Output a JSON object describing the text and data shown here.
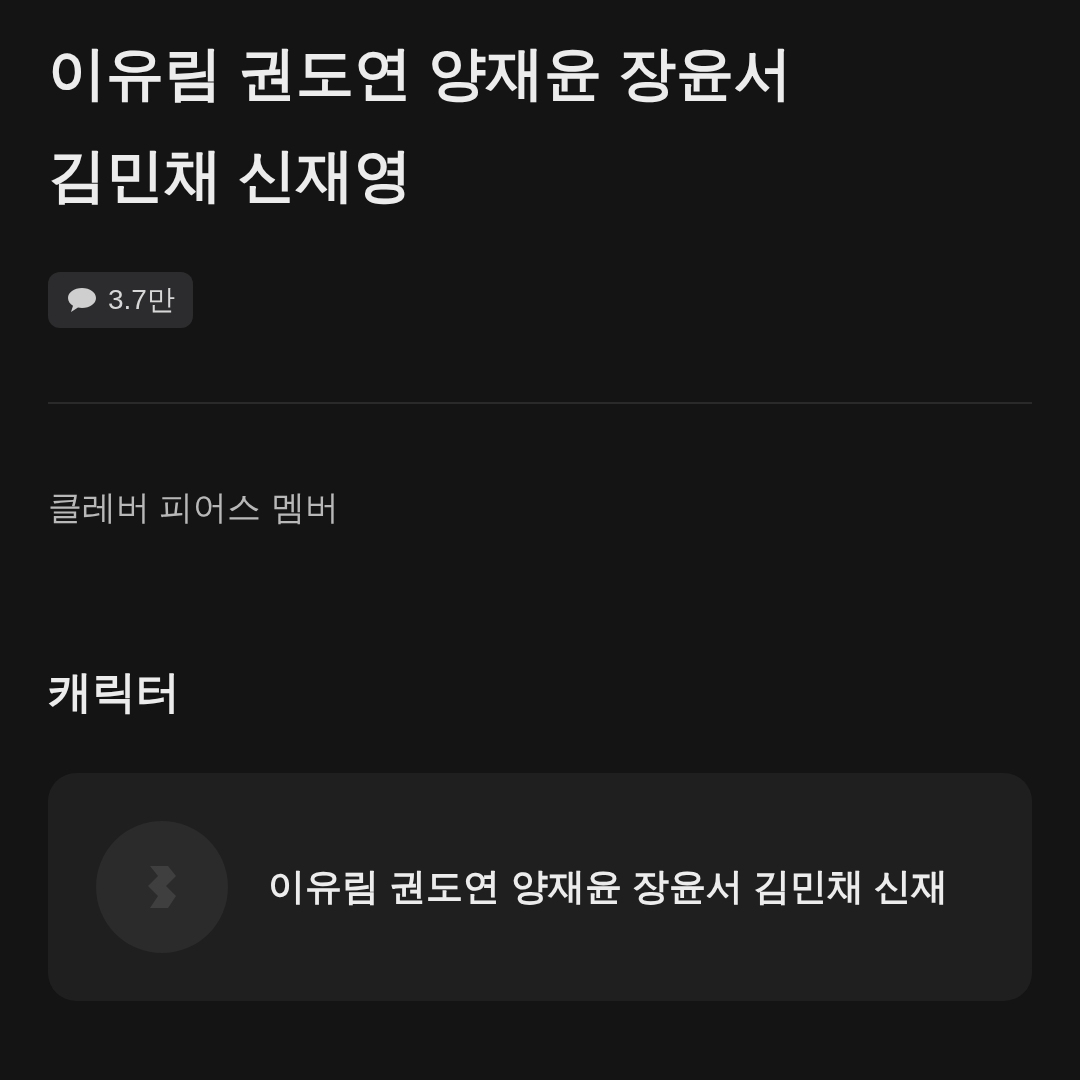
{
  "title": "이유림 권도연 양재윤 장윤서 김민채 신재영",
  "comment_count": "3.7만",
  "description": "클레버 피어스 멤버",
  "characters_section": {
    "heading": "캐릭터",
    "items": [
      {
        "name": "이유림 권도연 양재윤 장윤서 김민채 신재"
      }
    ]
  }
}
